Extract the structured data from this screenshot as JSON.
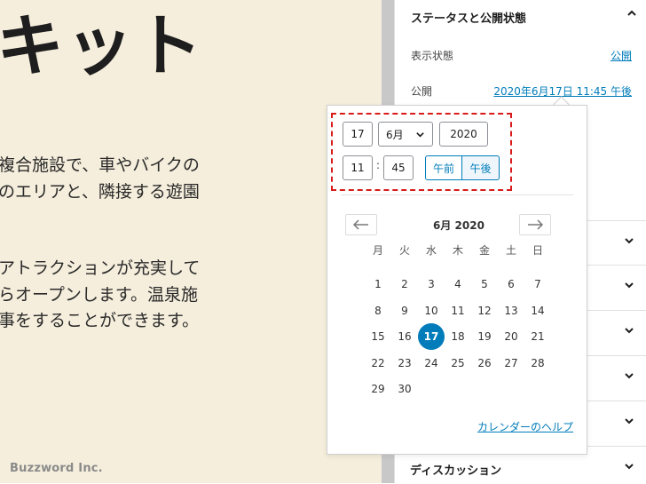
{
  "editor": {
    "title": "キット",
    "paragraph1": [
      "複合施設で、車やバイクの",
      "のエリアと、隣接する遊園"
    ],
    "paragraph2": [
      "アトラクションが充実して",
      "らオープンします。温泉施",
      "事をすることができます。"
    ],
    "footer_brand": "Buzzword Inc."
  },
  "sidebar": {
    "status_panel_title": "ステータスと公開状態",
    "visibility_label": "表示状態",
    "visibility_value": "公開",
    "publish_label": "公開",
    "publish_value": "2020年6月17日 11:45 午後",
    "discussion_title": "ディスカッション"
  },
  "datetime": {
    "day": "17",
    "month": "6月",
    "year": "2020",
    "hours": "11",
    "minutes": "45",
    "am_label": "午前",
    "pm_label": "午後",
    "selected_period": "午後"
  },
  "calendar": {
    "month_label": "6月 2020",
    "prev_icon": "arrow-left-icon",
    "next_icon": "arrow-right-icon",
    "weekdays": [
      "月",
      "火",
      "水",
      "木",
      "金",
      "土",
      "日"
    ],
    "weeks": [
      [
        "1",
        "2",
        "3",
        "4",
        "5",
        "6",
        "7"
      ],
      [
        "8",
        "9",
        "10",
        "11",
        "12",
        "13",
        "14"
      ],
      [
        "15",
        "16",
        "17",
        "18",
        "19",
        "20",
        "21"
      ],
      [
        "22",
        "23",
        "24",
        "25",
        "26",
        "27",
        "28"
      ],
      [
        "29",
        "30"
      ]
    ],
    "selected_day": "17",
    "help_link": "カレンダーのヘルプ"
  },
  "colors": {
    "accent": "#007cba",
    "highlight": "#d81b1b",
    "editor_bg": "#f5eedc"
  }
}
